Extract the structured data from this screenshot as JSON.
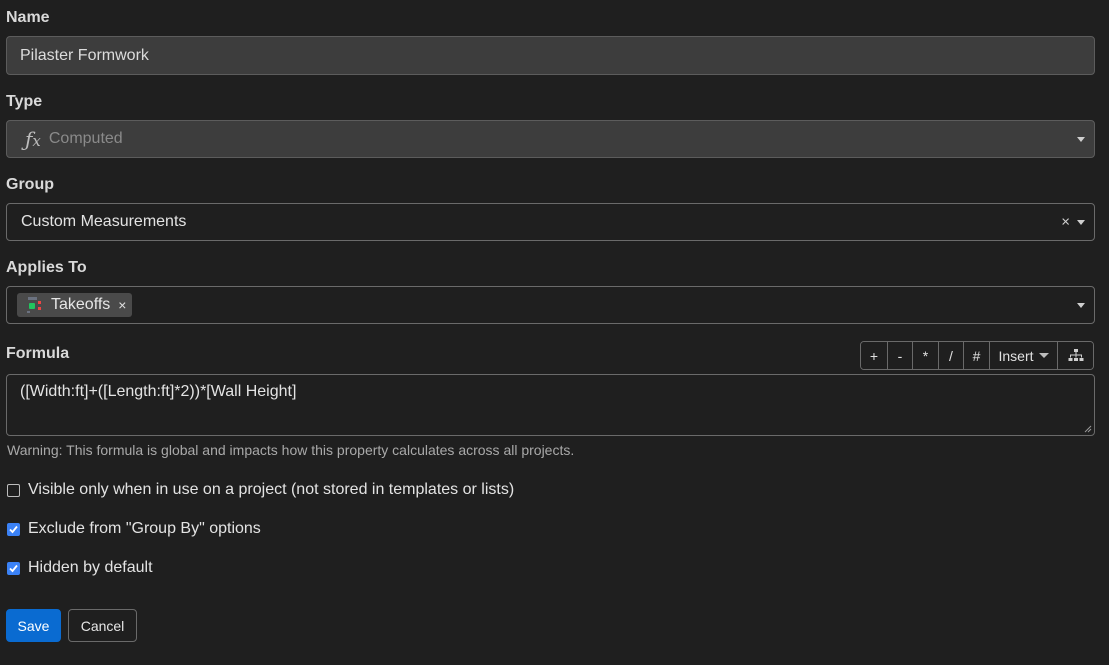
{
  "name": {
    "label": "Name",
    "value": "Pilaster Formwork"
  },
  "type": {
    "label": "Type",
    "value": "Computed",
    "icon": "function-icon"
  },
  "group": {
    "label": "Group",
    "value": "Custom Measurements",
    "clear": "×"
  },
  "applies_to": {
    "label": "Applies To",
    "chip_label": "Takeoffs",
    "chip_remove": "×",
    "chip_icon": "takeoff-icon"
  },
  "formula": {
    "label": "Formula",
    "value": "([Width:ft]+([Length:ft]*2))*[Wall Height]",
    "toolbar": {
      "plus": "+",
      "minus": "-",
      "multiply": "*",
      "divide": "/",
      "hash": "#",
      "insert": "Insert"
    },
    "warning": "Warning: This formula is global and impacts how this property calculates across all projects."
  },
  "options": {
    "visible_only": {
      "label": "Visible only when in use on a project (not stored in templates or lists)",
      "checked": false
    },
    "exclude_group_by": {
      "label": "Exclude from \"Group By\" options",
      "checked": true
    },
    "hidden_default": {
      "label": "Hidden by default",
      "checked": true
    }
  },
  "actions": {
    "save": "Save",
    "cancel": "Cancel"
  },
  "colors": {
    "background": "#1f1f1f",
    "primary": "#0a6bd1",
    "checkbox": "#3b82f6",
    "chip_icon_green": "#22c55e",
    "chip_icon_red": "#ef4444"
  }
}
